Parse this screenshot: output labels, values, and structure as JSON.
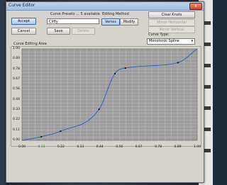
{
  "window": {
    "title": "Curve Editor",
    "close_label": "x"
  },
  "buttons": {
    "accept": "Accept",
    "cancel": "Cancel",
    "save": "Save",
    "delete": "Delete",
    "vertex": "Vertex",
    "modify": "Modify",
    "clear_knots": "Clear Knots",
    "mirror_horizontal": "Mirror Horizontal",
    "mirror_vertical": "Mirror Vertical"
  },
  "presets": {
    "label": "Curve Presets ... 5 available",
    "value": "Cliffy"
  },
  "editing": {
    "label": "Editing Method"
  },
  "curve_type": {
    "label": "Curve Type:",
    "value": "Monotonic Spline"
  },
  "area": {
    "label": "Curve Editing Area"
  },
  "chart_data": {
    "type": "line",
    "title": "Curve Editing Area",
    "xlim": [
      0,
      1
    ],
    "ylim": [
      0,
      1
    ],
    "grid": true,
    "x_ticks": [
      "0.00",
      "0.11",
      "0.22",
      "0.33",
      "0.44",
      "0.56",
      "0.67",
      "0.78",
      "0.89",
      "1.00"
    ],
    "y_ticks": [
      "1.00",
      "0.89",
      "0.78",
      "0.67",
      "0.56",
      "0.44",
      "0.33",
      "0.22",
      "0.11",
      "0.00"
    ],
    "knots": [
      {
        "x": 0.0,
        "y": 0.0
      },
      {
        "x": 0.11,
        "y": 0.04
      },
      {
        "x": 0.22,
        "y": 0.1
      },
      {
        "x": 0.44,
        "y": 0.34
      },
      {
        "x": 0.53,
        "y": 0.73
      },
      {
        "x": 0.59,
        "y": 0.79
      },
      {
        "x": 0.89,
        "y": 0.85
      },
      {
        "x": 1.0,
        "y": 1.0
      }
    ],
    "line_color": "#1f5fc8",
    "grid_color": "#cbcbcb",
    "plot_bg": "#9d9d9d"
  }
}
